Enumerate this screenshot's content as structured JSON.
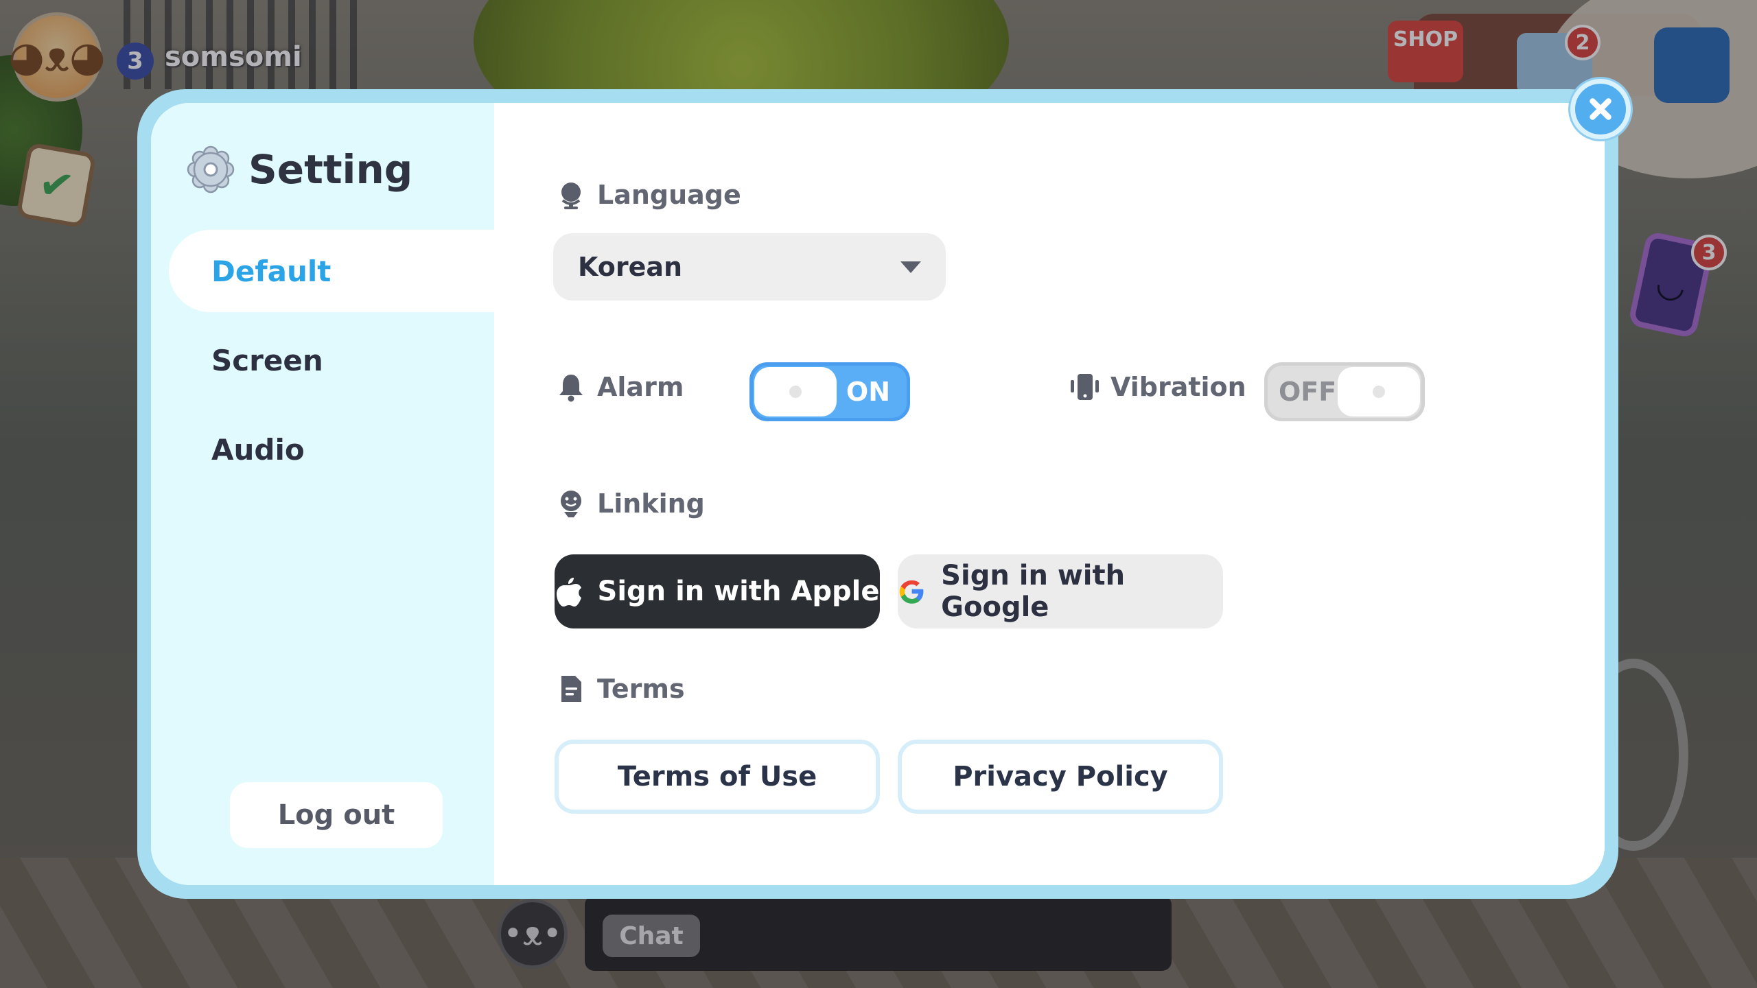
{
  "hud": {
    "level": "3",
    "player_name": "somsomi",
    "shop_label": "SHOP",
    "mail_badge": "2",
    "phone_badge": "3"
  },
  "chat": {
    "button_label": "Chat"
  },
  "settings": {
    "title": "Setting",
    "tabs": [
      {
        "label": "Default",
        "active": true
      },
      {
        "label": "Screen",
        "active": false
      },
      {
        "label": "Audio",
        "active": false
      }
    ],
    "logout_label": "Log out",
    "language": {
      "label": "Language",
      "value": "Korean"
    },
    "alarm": {
      "label": "Alarm",
      "state": "ON"
    },
    "vibration": {
      "label": "Vibration",
      "state": "OFF"
    },
    "linking": {
      "label": "Linking",
      "apple_label": "Sign in with Apple",
      "google_label": "Sign in with Google"
    },
    "terms": {
      "label": "Terms",
      "terms_of_use": "Terms of Use",
      "privacy_policy": "Privacy Policy"
    }
  },
  "colors": {
    "accent": "#2aa4e6",
    "toggle_on": "#5aaef6",
    "modal_frame": "#a6ddf0",
    "sidebar_bg": "#e1fafd"
  }
}
